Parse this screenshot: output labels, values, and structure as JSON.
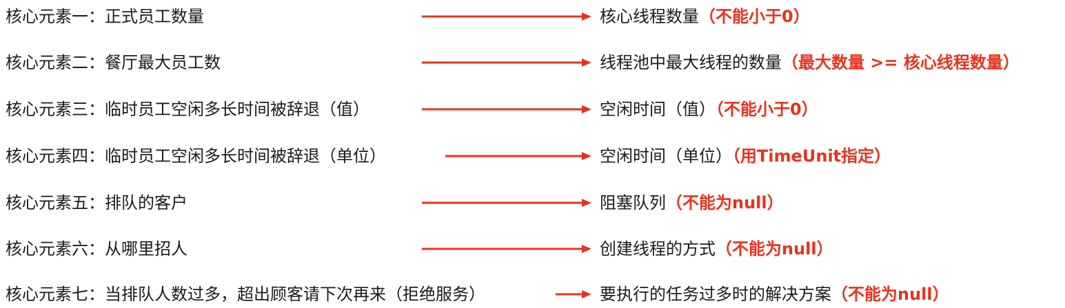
{
  "rows": [
    {
      "left": "核心元素一：正式员工数量",
      "right": "核心线程数量",
      "note": "（不能小于0）"
    },
    {
      "left": "核心元素二：餐厅最大员工数",
      "right": "线程池中最大线程的数量",
      "note": "（最大数量 >= 核心线程数量）"
    },
    {
      "left": "核心元素三：临时员工空闲多长时间被辞退（值）",
      "right": "空闲时间（值）",
      "note": "（不能小于0）"
    },
    {
      "left": "核心元素四：临时员工空闲多长时间被辞退（单位）",
      "right": "空闲时间（单位）",
      "note": "（用TimeUnit指定）"
    },
    {
      "left": "核心元素五：排队的客户",
      "right": "阻塞队列",
      "note": "（不能为null）"
    },
    {
      "left": "核心元素六：从哪里招人",
      "right": "创建线程的方式",
      "note": "（不能为null）"
    },
    {
      "left": "核心元素七：当排队人数过多，超出顾客请下次再来（拒绝服务）",
      "right": "要执行的任务过多时的解决方案",
      "note": "（不能为null）"
    }
  ],
  "colors": {
    "text": "#1a1a1a",
    "accent": "#e8321c"
  }
}
